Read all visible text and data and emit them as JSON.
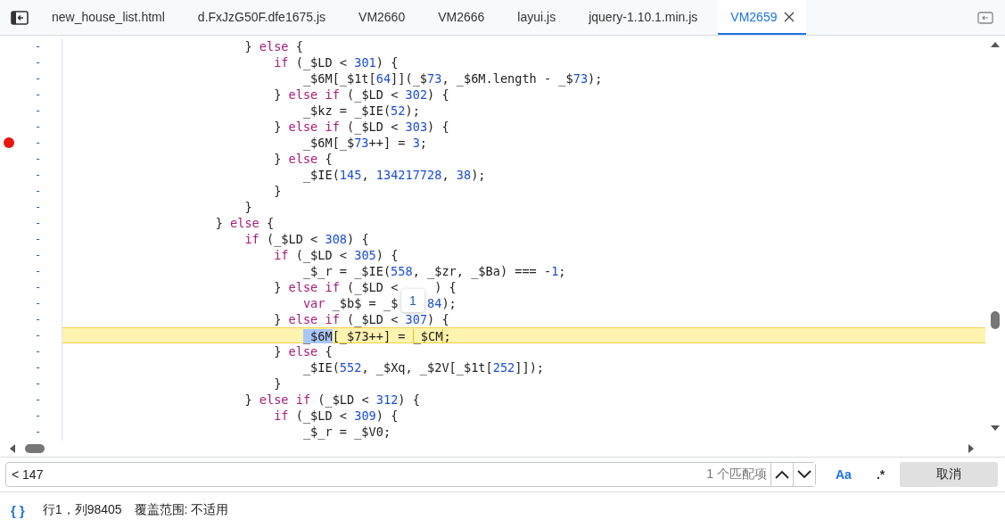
{
  "tabs": [
    {
      "label": "new_house_list.html",
      "selected": false
    },
    {
      "label": "d.FxJzG50F.dfe1675.js",
      "selected": false
    },
    {
      "label": "VM2660",
      "selected": false
    },
    {
      "label": "VM2666",
      "selected": false
    },
    {
      "label": "layui.js",
      "selected": false
    },
    {
      "label": "jquery-1.10.1.min.js",
      "selected": false
    },
    {
      "label": "VM2659",
      "selected": true
    }
  ],
  "editor": {
    "gutter_mark": "-",
    "lines": [
      {
        "text": "                        } else {",
        "breakpoint": false
      },
      {
        "text": "                            if (_$LD < 301) {",
        "breakpoint": false
      },
      {
        "text": "                                _$6M[_$1t[64]](_$73, _$6M.length - _$73);",
        "breakpoint": false
      },
      {
        "text": "                            } else if (_$LD < 302) {",
        "breakpoint": false
      },
      {
        "text": "                                _$kz = _$IE(52);",
        "breakpoint": false
      },
      {
        "text": "                            } else if (_$LD < 303) {",
        "breakpoint": false
      },
      {
        "text": "                                _$6M[_$73++] = 3;",
        "breakpoint": true
      },
      {
        "text": "                            } else {",
        "breakpoint": false
      },
      {
        "text": "                                _$IE(145, 134217728, 38);",
        "breakpoint": false
      },
      {
        "text": "                            }",
        "breakpoint": false
      },
      {
        "text": "                        }",
        "breakpoint": false
      },
      {
        "text": "                    } else {",
        "breakpoint": false
      },
      {
        "text": "                        if (_$LD < 308) {",
        "breakpoint": false
      },
      {
        "text": "                            if (_$LD < 305) {",
        "breakpoint": false
      },
      {
        "text": "                                _$_r = _$IE(558, _$zr, _$Ba) === -1;",
        "breakpoint": false
      },
      {
        "text": "                            } else if (_$LD <     ) {",
        "breakpoint": false
      },
      {
        "fragments": [
          "                                var _$b$ = _$",
          "84);"
        ],
        "breakpoint": false
      },
      {
        "text": "                            } else if (_$LD < 307) {",
        "breakpoint": false
      },
      {
        "parts": [
          {
            "kind": "selection",
            "text": "                                _$6M"
          },
          {
            "kind": "code",
            "text": "[_$73++] = "
          },
          {
            "kind": "match",
            "text": "_$CM"
          },
          {
            "kind": "code",
            "text": ";"
          }
        ],
        "breakpoint": false,
        "current": true
      },
      {
        "text": "                            } else {",
        "breakpoint": false
      },
      {
        "text": "                                _$IE(552, _$Xq, _$2V[_$1t[252]]);",
        "breakpoint": false
      },
      {
        "text": "                            }",
        "breakpoint": false
      },
      {
        "text": "                        } else if (_$LD < 312) {",
        "breakpoint": false
      },
      {
        "text": "                            if (_$LD < 309) {",
        "breakpoint": false
      },
      {
        "text": "                                _$_r = _$V0;",
        "breakpoint": false
      }
    ],
    "tooltip": "1"
  },
  "search": {
    "value": "< 147",
    "match_count": "1 个匹配项",
    "case_toggle": "Aa",
    "regex_toggle": ".*",
    "cancel": "取消"
  },
  "status_bar": {
    "format_icon": "{ }",
    "position": "行1，列98405",
    "coverage": "覆盖范围: 不适用"
  }
}
